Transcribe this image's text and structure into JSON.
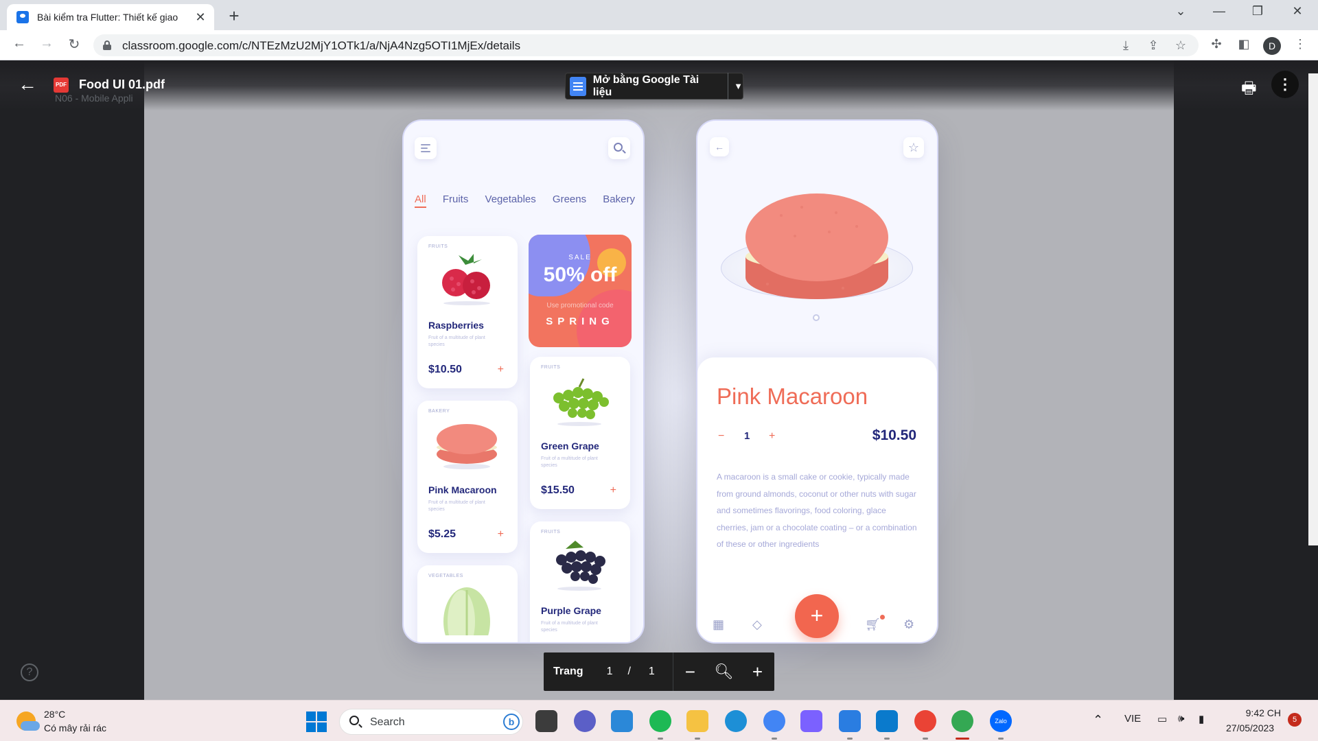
{
  "browser": {
    "tab_title": "Bài kiểm tra Flutter: Thiết kế giao",
    "tab_close": "✕",
    "new_tab": "+",
    "url": "classroom.google.com/c/NTEzMzU2MjY1OTk1/a/NjA4Nzg5OTI1MjEx/details",
    "profile_initial": "D",
    "window_controls": [
      "⌄",
      "—",
      "❐",
      "✕"
    ]
  },
  "viewer": {
    "file_name": "Food UI 01.pdf",
    "background_caption": "N06 - Mobile Appli",
    "open_with_label": "Mở bằng Google Tài liệu",
    "page_label": "Trang",
    "current_page": "1",
    "page_separator": "/",
    "total_pages": "1",
    "help": "?"
  },
  "app_list": {
    "categories": [
      "All",
      "Fruits",
      "Vegetables",
      "Greens",
      "Bakery"
    ],
    "active_category": "All",
    "products": [
      {
        "category": "FRUITS",
        "name": "Raspberries",
        "desc": "Fruit of a multitude of plant species",
        "price": "$10.50"
      },
      {
        "category": "BAKERY",
        "name": "Pink Macaroon",
        "desc": "Fruit of a multitude of plant species",
        "price": "$5.25"
      },
      {
        "category": "VEGETABLES",
        "name": "",
        "desc": "",
        "price": ""
      },
      {
        "category": "FRUITS",
        "name": "Green Grape",
        "desc": "Fruit of a multitude of plant species",
        "price": "$15.50"
      },
      {
        "category": "FRUITS",
        "name": "Purple Grape",
        "desc": "Fruit of a multitude of plant species",
        "price": ""
      }
    ],
    "add_symbol": "+",
    "sale": {
      "label": "SALE",
      "headline": "50% off",
      "promo_text": "Use promotional code",
      "code": "SPRING"
    }
  },
  "app_detail": {
    "title": "Pink Macaroon",
    "qty_minus": "−",
    "quantity": "1",
    "qty_plus": "+",
    "price": "$10.50",
    "description": "A macaroon is a small cake or cookie, typically made from ground almonds, coconut or other nuts with sugar and sometimes flavorings, food coloring, glace cherries, jam or a chocolate coating – or a combination of these or other ingredients",
    "fab_symbol": "+"
  },
  "taskbar": {
    "temperature": "28°C",
    "weather": "Có mây rải rác",
    "search_label": "Search",
    "bing_label": "b",
    "language": "VIE",
    "time": "9:42 CH",
    "date": "27/05/2023",
    "notifications": "5",
    "apps": [
      {
        "name": "file-manager",
        "color": "#3c3c3c"
      },
      {
        "name": "teams",
        "color": "#5b5fc7"
      },
      {
        "name": "todo",
        "color": "#2b88d8"
      },
      {
        "name": "spotify",
        "color": "#1db954"
      },
      {
        "name": "file-explorer",
        "color": "#f5c242"
      },
      {
        "name": "edge",
        "color": "#1d8fd6"
      },
      {
        "name": "chrome-dev",
        "color": "#4285f4"
      },
      {
        "name": "copilot",
        "color": "#7b61ff"
      },
      {
        "name": "notepad",
        "color": "#2a7de1"
      },
      {
        "name": "vscode",
        "color": "#0a7acc"
      },
      {
        "name": "chrome",
        "color": "#ea4335"
      },
      {
        "name": "chrome-profile",
        "color": "#34a853"
      },
      {
        "name": "zalo",
        "color": "#0068ff"
      }
    ],
    "zalo_label": "Zalo"
  }
}
